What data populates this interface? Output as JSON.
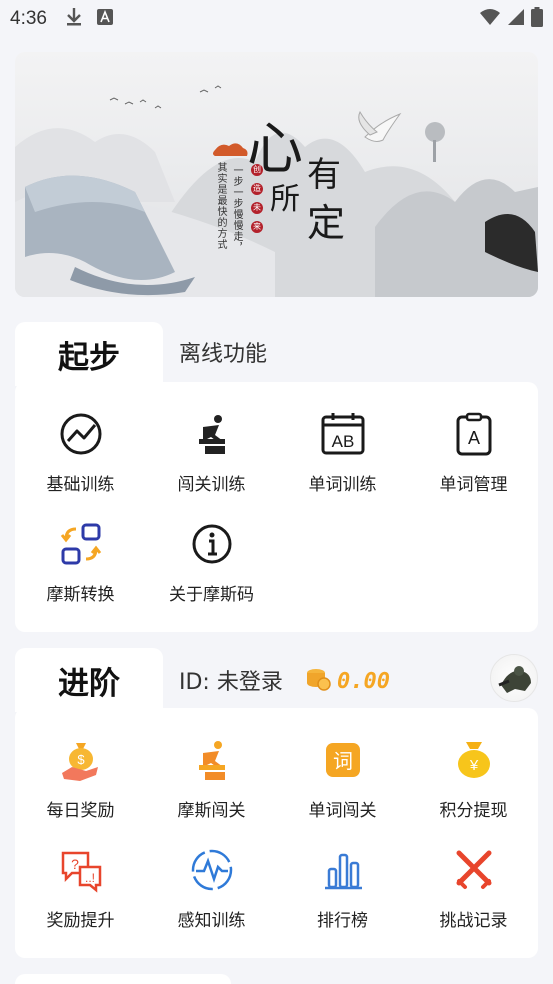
{
  "status_bar": {
    "time": "4:36",
    "left_icons": [
      "download-icon",
      "font-a-icon"
    ],
    "right_icons": [
      "wifi-icon",
      "signal-icon",
      "battery-icon"
    ]
  },
  "banner": {
    "big_chars": [
      "心",
      "有",
      "所",
      "定"
    ],
    "vertical_line_1": "一步一步慢慢走，",
    "vertical_line_2": "其实是最快的方式",
    "seal_chars": [
      "创",
      "造",
      "未",
      "来"
    ]
  },
  "section1": {
    "tab_active": "起步",
    "tab_inactive": "离线功能",
    "items": [
      {
        "label": "基础训练",
        "icon": "trend-chart-icon"
      },
      {
        "label": "闯关训练",
        "icon": "jumping-runner-icon"
      },
      {
        "label": "单词训练",
        "icon": "calendar-ab-icon"
      },
      {
        "label": "单词管理",
        "icon": "clipboard-a-icon"
      },
      {
        "label": "摩斯转换",
        "icon": "swap-boxes-icon"
      },
      {
        "label": "关于摩斯码",
        "icon": "info-icon"
      }
    ]
  },
  "section2": {
    "tab_active": "进阶",
    "user_id": "ID: 未登录",
    "coins": "0.00",
    "items": [
      {
        "label": "每日奖励",
        "icon": "money-bag-hand-icon"
      },
      {
        "label": "摩斯闯关",
        "icon": "orange-runner-icon"
      },
      {
        "label": "单词闯关",
        "icon": "word-tile-icon"
      },
      {
        "label": "积分提现",
        "icon": "yuan-bag-icon"
      },
      {
        "label": "奖励提升",
        "icon": "question-chat-icon"
      },
      {
        "label": "感知训练",
        "icon": "pulse-circle-icon"
      },
      {
        "label": "排行榜",
        "icon": "bar-chart-icon"
      },
      {
        "label": "挑战记录",
        "icon": "crossed-swords-icon"
      }
    ]
  },
  "colors": {
    "background": "#f4f5f9",
    "accent_orange": "#f5a623",
    "accent_blue": "#3a7bd5",
    "accent_red": "#e8452c",
    "seal_red": "#b3212b"
  }
}
